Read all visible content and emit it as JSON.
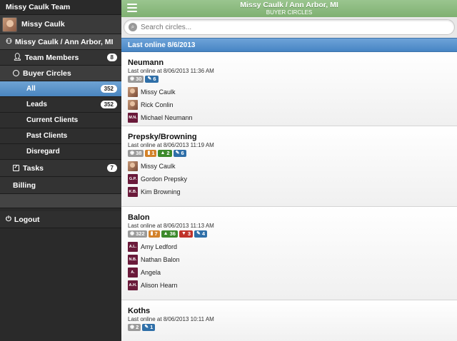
{
  "sidebar": {
    "team": "Missy Caulk Team",
    "user": "Missy Caulk",
    "location": "Missy Caulk / Ann Arbor, MI",
    "team_members": {
      "label": "Team Members",
      "count": "8"
    },
    "buyer_circles": "Buyer Circles",
    "circles": [
      {
        "label": "All",
        "count": "352",
        "active": true
      },
      {
        "label": "Leads",
        "count": "352"
      },
      {
        "label": "Current Clients"
      },
      {
        "label": "Past Clients"
      },
      {
        "label": "Disregard"
      }
    ],
    "tasks": {
      "label": "Tasks",
      "count": "7"
    },
    "billing": "Billing",
    "logout": "Logout"
  },
  "header": {
    "title": "Missy Caulk / Ann Arbor, MI",
    "subtitle": "BUYER CIRCLES"
  },
  "search": {
    "placeholder": "Search circles..."
  },
  "section": {
    "label": "Last online 8/6/2013"
  },
  "circles": [
    {
      "name": "Neumann",
      "online": "Last online at 8/06/2013 11:36 AM",
      "stats": {
        "views": "30",
        "comments": "6"
      },
      "members": [
        {
          "name": "Missy Caulk",
          "initials": ""
        },
        {
          "name": "Rick Conlin",
          "initials": ""
        },
        {
          "name": "Michael Neumann",
          "initials": "M.N."
        }
      ]
    },
    {
      "name": "Prepsky/Browning",
      "online": "Last online at 8/06/2013 11:19 AM",
      "stats": {
        "views": "38",
        "bookmark": "1",
        "likes": "2",
        "comments": "6"
      },
      "members": [
        {
          "name": "Missy Caulk",
          "initials": ""
        },
        {
          "name": "Gordon Prepsky",
          "initials": "G.P."
        },
        {
          "name": "Kim Browning",
          "initials": "K.B."
        }
      ]
    },
    {
      "name": "Balon",
      "online": "Last online at 8/06/2013 11:13 AM",
      "stats": {
        "views": "322",
        "bookmark": "7",
        "likes": "36",
        "dislikes": "3",
        "comments": "4"
      },
      "members": [
        {
          "name": "Amy Ledford",
          "initials": "A.L."
        },
        {
          "name": "Nathan Balon",
          "initials": "N.B."
        },
        {
          "name": "Angela",
          "initials": "A."
        },
        {
          "name": "Alison Hearn",
          "initials": "A.H."
        }
      ]
    },
    {
      "name": "Koths",
      "online": "Last online at 8/06/2013 10:11 AM",
      "stats": {
        "views": "2",
        "comments": "1"
      },
      "members": []
    }
  ],
  "colors": {
    "header": "#8dbb80",
    "accent": "#4a86c0",
    "sidebar": "#2a2a2a",
    "initials_bg": "#6a1a3a"
  }
}
